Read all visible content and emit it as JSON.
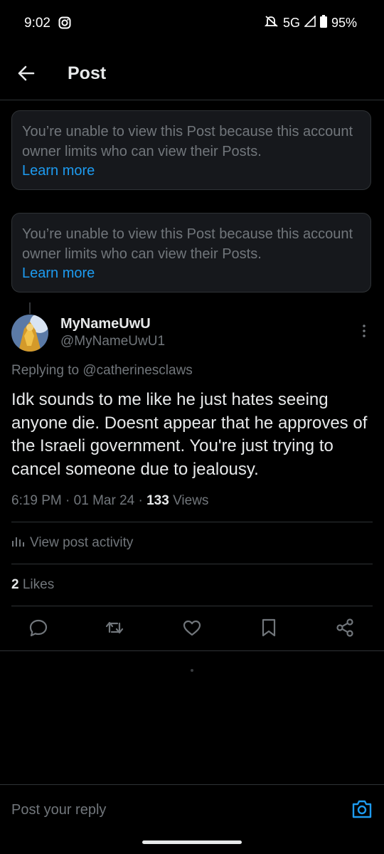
{
  "status_bar": {
    "time": "9:02",
    "network": "5G",
    "battery": "95%"
  },
  "header": {
    "title": "Post"
  },
  "notices": [
    {
      "text": "You’re unable to view this Post because this account owner limits who can view their Posts.",
      "link": "Learn more"
    },
    {
      "text": "You’re unable to view this Post because this account owner limits who can view their Posts.",
      "link": "Learn more"
    }
  ],
  "post": {
    "author_name": "MyNameUwU",
    "author_handle": "@MyNameUwU1",
    "replying_prefix": "Replying to",
    "replying_to": "@catherinesclaws",
    "text": "Idk sounds to me like he just hates seeing anyone die. Doesnt appear that he approves of the Israeli government. You're just trying to cancel someone due to jealousy.",
    "time": "6:19 PM",
    "date": "01 Mar 24",
    "views_count": "133",
    "views_label": "Views",
    "activity_label": "View post activity",
    "likes_count": "2",
    "likes_label": "Likes"
  },
  "reply": {
    "placeholder": "Post your reply"
  },
  "colors": {
    "accent": "#1d9bf0",
    "muted": "#71767b",
    "text": "#e7e9ea",
    "card": "#16181c",
    "border": "#2f3336"
  }
}
